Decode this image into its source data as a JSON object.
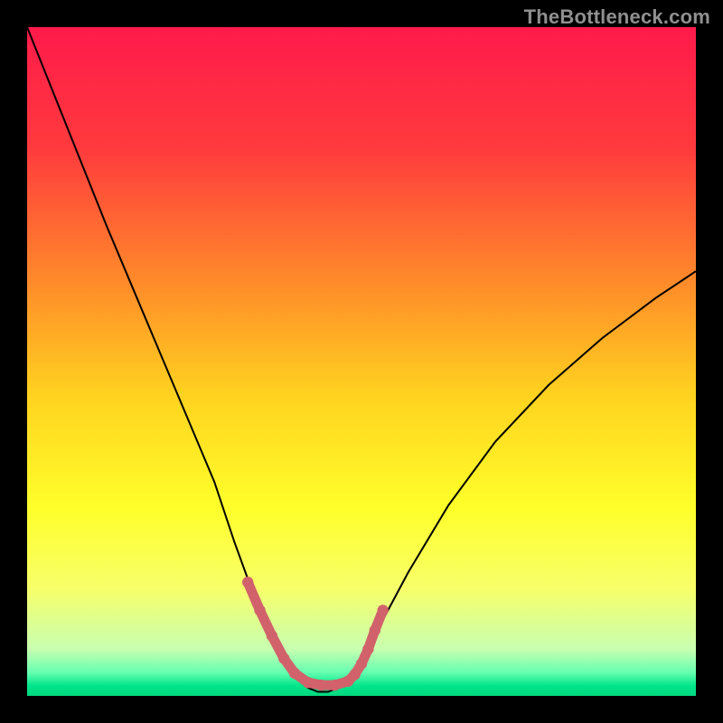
{
  "watermark": "TheBottleneck.com",
  "chart_data": {
    "type": "line",
    "title": "",
    "xlabel": "",
    "ylabel": "",
    "xlim": [
      0,
      100
    ],
    "ylim": [
      0,
      100
    ],
    "grid": false,
    "legend": false,
    "background_gradient_stops": [
      {
        "offset": 0.0,
        "color": "#ff1a4b"
      },
      {
        "offset": 0.18,
        "color": "#ff3a3d"
      },
      {
        "offset": 0.38,
        "color": "#ff8a2a"
      },
      {
        "offset": 0.55,
        "color": "#ffd21f"
      },
      {
        "offset": 0.72,
        "color": "#ffff2a"
      },
      {
        "offset": 0.84,
        "color": "#f7ff6a"
      },
      {
        "offset": 0.93,
        "color": "#c8ffb0"
      },
      {
        "offset": 0.965,
        "color": "#66ffb0"
      },
      {
        "offset": 0.985,
        "color": "#00e58a"
      },
      {
        "offset": 1.0,
        "color": "#00d87e"
      }
    ],
    "series": [
      {
        "name": "bottleneck-curve",
        "stroke": "#000000",
        "stroke_width": 2.0,
        "x": [
          0,
          4,
          8,
          12,
          16,
          20,
          24,
          28,
          31,
          33,
          34.5,
          36,
          38,
          40,
          42,
          43.5,
          45,
          46.5,
          48,
          50,
          53,
          57,
          63,
          70,
          78,
          86,
          94,
          100
        ],
        "y": [
          100,
          90,
          80,
          70,
          60.5,
          51,
          41.5,
          32,
          23,
          17.5,
          13.5,
          10,
          5.6,
          2.8,
          1.2,
          0.6,
          0.6,
          1.2,
          2.6,
          5.6,
          11,
          18.5,
          28.5,
          38,
          46.5,
          53.5,
          59.5,
          63.5
        ]
      },
      {
        "name": "optimal-zone-marker",
        "stroke": "#d1626b",
        "stroke_width": 11,
        "linecap": "round",
        "marker_radius": 6.2,
        "x": [
          33.0,
          34.8,
          36.6,
          38.4,
          40.0,
          42.0,
          44.0,
          46.0,
          48.0,
          49.0,
          50.0,
          51.0,
          52.0,
          53.2
        ],
        "y": [
          17.0,
          12.8,
          9.0,
          5.6,
          3.4,
          2.0,
          1.6,
          1.6,
          2.2,
          3.2,
          4.8,
          7.0,
          9.8,
          12.8
        ]
      }
    ]
  }
}
